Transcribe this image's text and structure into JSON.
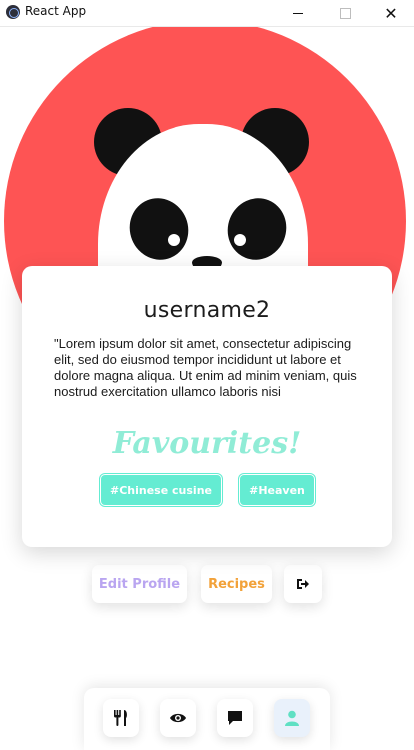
{
  "window": {
    "title": "React App",
    "minimize_label": "",
    "close_label": "✕"
  },
  "profile": {
    "username": "username2",
    "bio": "\"Lorem ipsum dolor sit amet, consectetur adipiscing elit, sed do eiusmod tempor incididunt ut labore et dolore magna aliqua. Ut enim ad minim veniam, quis nostrud exercitation ullamco laboris nisi",
    "favourites_heading": "Favourites!",
    "tags": [
      "#Chinese cusine",
      "#Heaven"
    ]
  },
  "actions": {
    "edit_profile_label": "Edit Profile",
    "recipes_label": "Recipes",
    "logout_icon": "logout-icon"
  },
  "bottom_nav": {
    "items": [
      {
        "icon": "fork-knife-icon",
        "active": false
      },
      {
        "icon": "eye-icon",
        "active": false
      },
      {
        "icon": "chat-icon",
        "active": false
      },
      {
        "icon": "user-icon",
        "active": true
      }
    ]
  },
  "colors": {
    "hero_red": "#fe5454",
    "tag_teal": "#64ecd2",
    "favourites_teal": "#90ecd6",
    "edit_purple": "#b9a5f0",
    "recipes_orange": "#f2a23a",
    "active_user": "#5fe0c3"
  }
}
